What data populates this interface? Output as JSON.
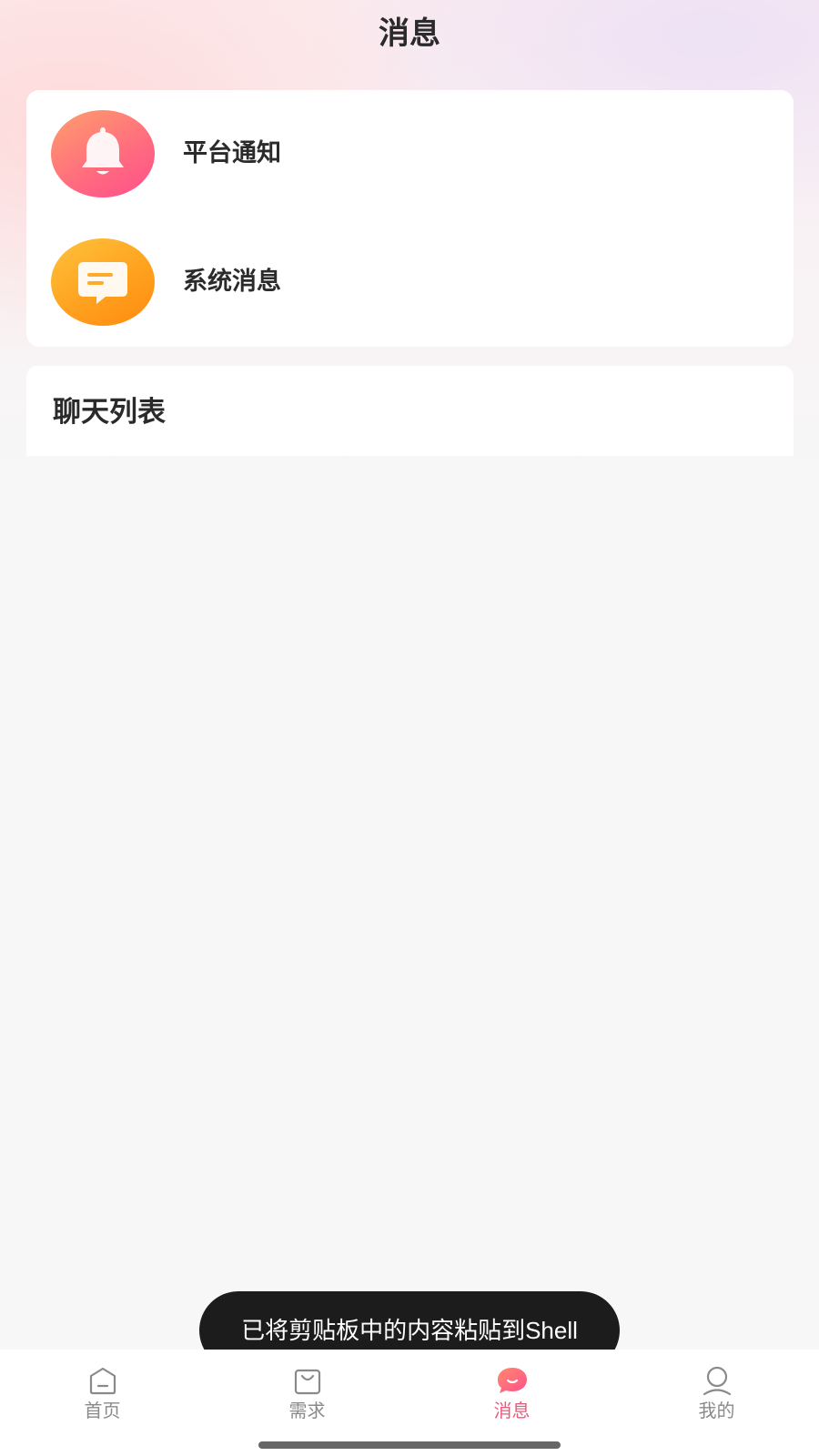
{
  "header": {
    "title": "消息"
  },
  "notices": [
    {
      "label": "平台通知",
      "icon": "bell-icon"
    },
    {
      "label": "系统消息",
      "icon": "message-icon"
    }
  ],
  "chat": {
    "title": "聊天列表"
  },
  "toast": {
    "text": "已将剪贴板中的内容粘贴到Shell"
  },
  "tabbar": {
    "items": [
      {
        "label": "首页",
        "icon": "home-icon",
        "active": false
      },
      {
        "label": "需求",
        "icon": "bag-icon",
        "active": false
      },
      {
        "label": "消息",
        "icon": "chat-bubble-icon",
        "active": true
      },
      {
        "label": "我的",
        "icon": "user-icon",
        "active": false
      }
    ]
  },
  "colors": {
    "accent": "#e85a7b",
    "bell_gradient": [
      "#ff9f6c",
      "#ff4f8b"
    ],
    "message_gradient": [
      "#ffc23d",
      "#ff8a0f"
    ],
    "tab_inactive": "#8a8a8a"
  }
}
